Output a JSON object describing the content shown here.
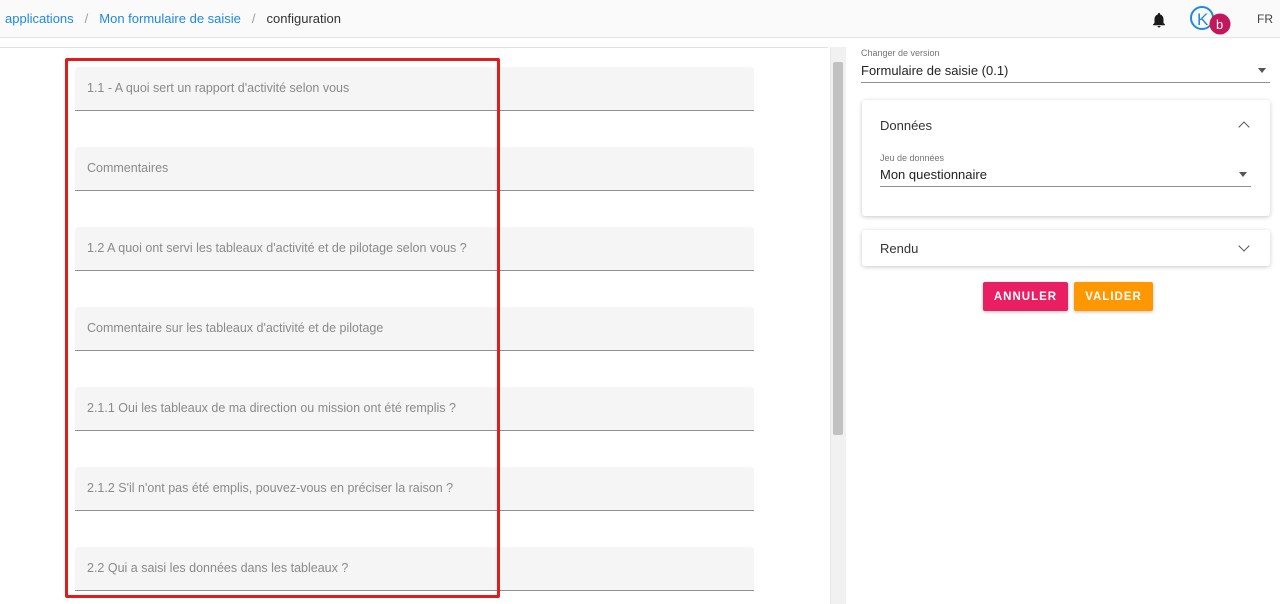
{
  "breadcrumb": {
    "items": [
      {
        "label": "applications"
      },
      {
        "label": "Mon formulaire de saisie"
      }
    ],
    "separator": "/",
    "current": "configuration"
  },
  "header": {
    "language": "FR",
    "avatar_letter": "b",
    "logo_letter": "K",
    "icons": [
      "bell-icon",
      "k-logo-icon"
    ]
  },
  "form": {
    "fields": [
      {
        "label": "1.1 - A quoi sert un rapport d'activité selon vous"
      },
      {
        "label": "Commentaires"
      },
      {
        "label": "1.2 A quoi ont servi les tableaux d'activité et de pilotage selon vous ?"
      },
      {
        "label": "Commentaire sur les tableaux d'activité et de pilotage"
      },
      {
        "label": "2.1.1 Oui les tableaux de ma direction ou mission ont été remplis ?"
      },
      {
        "label": "2.1.2 S'il n'ont pas été emplis, pouvez-vous en préciser la raison ?"
      },
      {
        "label": "2.2 Qui a saisi les données dans les tableaux ?"
      }
    ]
  },
  "sidebar": {
    "version_label": "Changer de version",
    "version_value": "Formulaire de saisie (0.1)",
    "data_panel": {
      "title": "Données",
      "dataset_label": "Jeu de données",
      "dataset_value": "Mon questionnaire"
    },
    "render_panel": {
      "title": "Rendu"
    },
    "buttons": {
      "cancel": "ANNULER",
      "validate": "VALIDER"
    }
  },
  "colors": {
    "link": "#1e88e5",
    "cancel": "#e91e63",
    "validate": "#ff9800",
    "highlight": "#e21b1b",
    "avatar": "#c2185b",
    "logo": "#1e88e5"
  }
}
